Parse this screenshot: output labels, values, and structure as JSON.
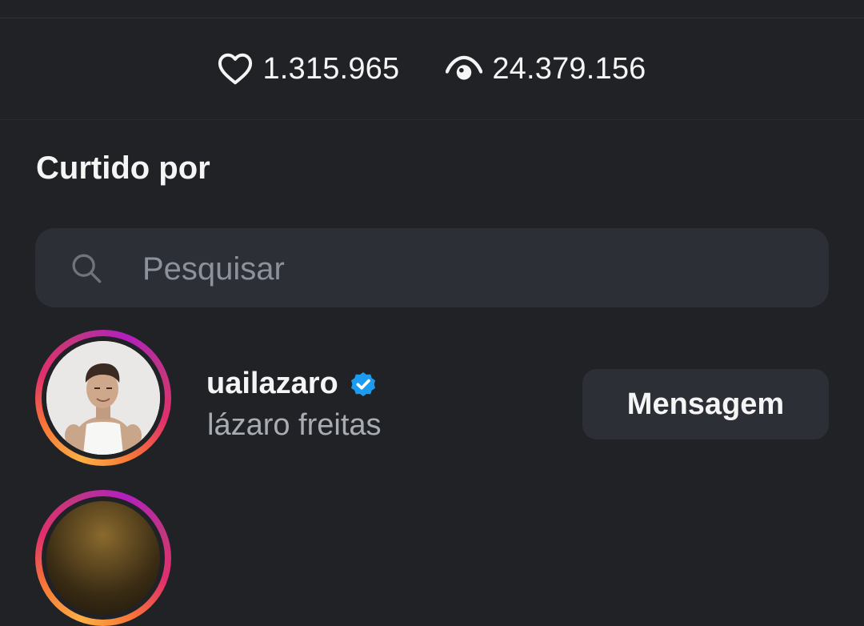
{
  "stats": {
    "likes_count": "1.315.965",
    "views_count": "24.379.156",
    "likes_icon": "heart-outline-icon",
    "views_icon": "eye-icon"
  },
  "section": {
    "title": "Curtido por"
  },
  "search": {
    "placeholder": "Pesquisar",
    "value": "",
    "icon": "search-icon"
  },
  "users": [
    {
      "username": "uailazaro",
      "full_name": "lázaro freitas",
      "verified": true,
      "action_label": "Mensagem"
    }
  ],
  "colors": {
    "background": "#212226",
    "surface": "#2c2f36",
    "text_primary": "#f5f5f5",
    "text_secondary": "#a8acb3",
    "verified_blue": "#1d9bf0"
  }
}
